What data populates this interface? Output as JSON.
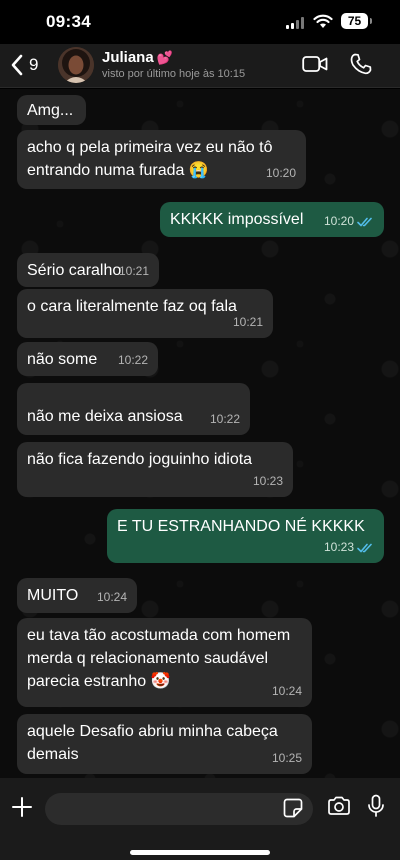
{
  "status_bar": {
    "time": "09:34",
    "battery": "75"
  },
  "header": {
    "back_count": "9",
    "contact_name": "Juliana",
    "contact_emoji": "💕",
    "last_seen": "visto por último hoje às 10:15"
  },
  "messages": [
    {
      "dir": "in",
      "text": "Amg...",
      "time": ""
    },
    {
      "dir": "in",
      "text": "acho q pela primeira vez eu não tô entrando numa furada 😭",
      "time": "10:20"
    },
    {
      "dir": "out",
      "text": "KKKKK impossível",
      "time": "10:20",
      "status": "read"
    },
    {
      "dir": "in",
      "text": "Sério caralho",
      "time": "10:21"
    },
    {
      "dir": "in",
      "text": "o cara literalmente faz oq fala",
      "time": "10:21"
    },
    {
      "dir": "in",
      "text": "não some",
      "time": "10:22"
    },
    {
      "dir": "in",
      "text": "não me deixa ansiosa",
      "time": "10:22"
    },
    {
      "dir": "in",
      "text": "não fica fazendo joguinho idiota",
      "time": "10:23"
    },
    {
      "dir": "out",
      "text": "E TU ESTRANHANDO NÉ KKKKK",
      "time": "10:23",
      "status": "read"
    },
    {
      "dir": "in",
      "text": "MUITO",
      "time": "10:24"
    },
    {
      "dir": "in",
      "text": "eu tava tão acostumada com homem merda q relacionamento saudável parecia estranho 🤡",
      "time": "10:24"
    },
    {
      "dir": "in",
      "text": "aquele Desafio abriu minha cabeça demais",
      "time": "10:25"
    }
  ],
  "icons": {
    "back": "chevron-left-icon",
    "video": "video-camera-icon",
    "call": "phone-icon",
    "plus": "plus-icon",
    "sticker": "sticker-icon",
    "camera": "camera-icon",
    "mic": "microphone-icon"
  },
  "colors": {
    "incoming_bubble": "#2b2b2b",
    "outgoing_bubble": "#1e5a43",
    "read_ticks": "#53bdeb",
    "background": "#0c0c0c"
  }
}
